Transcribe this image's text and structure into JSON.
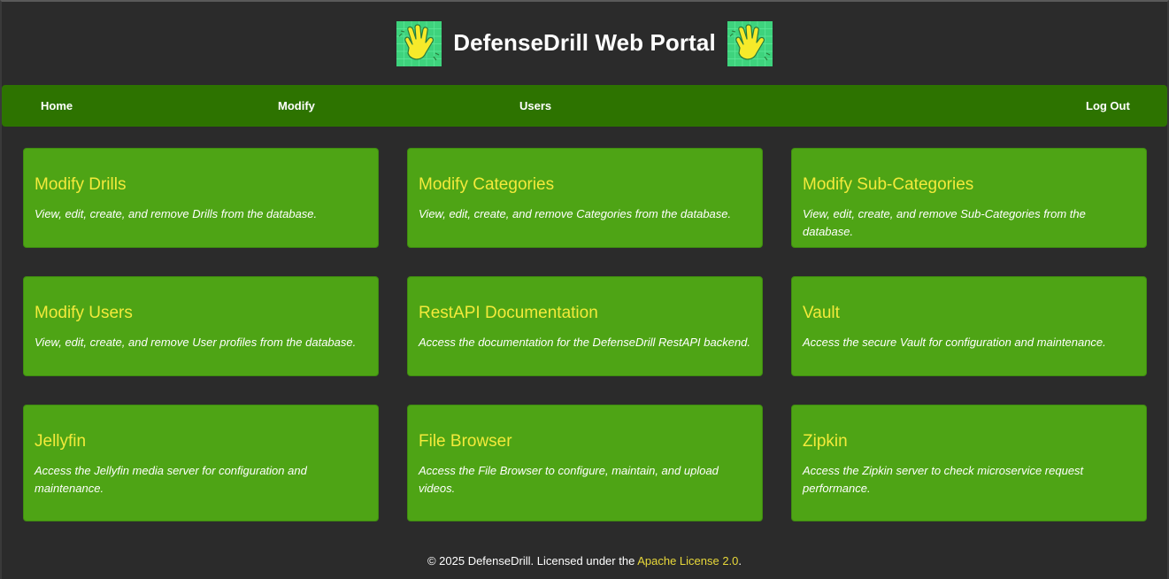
{
  "header": {
    "title": "DefenseDrill Web Portal",
    "logo_icon": "raised-hand-icon"
  },
  "nav": {
    "items": [
      {
        "label": "Home"
      },
      {
        "label": "Modify"
      },
      {
        "label": "Users"
      },
      {
        "label": "Log Out"
      }
    ]
  },
  "cards": [
    {
      "title": "Modify Drills",
      "description": "View, edit, create, and remove Drills from the database."
    },
    {
      "title": "Modify Categories",
      "description": "View, edit, create, and remove Categories from the database."
    },
    {
      "title": "Modify Sub-Categories",
      "description": "View, edit, create, and remove Sub-Categories from the database."
    },
    {
      "title": "Modify Users",
      "description": "View, edit, create, and remove User profiles from the database."
    },
    {
      "title": "RestAPI Documentation",
      "description": "Access the documentation for the DefenseDrill RestAPI backend."
    },
    {
      "title": "Vault",
      "description": "Access the secure Vault for configuration and maintenance."
    },
    {
      "title": "Jellyfin",
      "description": "Access the Jellyfin media server for configuration and maintenance."
    },
    {
      "title": "File Browser",
      "description": "Access the File Browser to configure, maintain, and upload videos."
    },
    {
      "title": "Zipkin",
      "description": "Access the Zipkin server to check microservice request performance."
    }
  ],
  "footer": {
    "text": "© 2025 DefenseDrill. Licensed under the ",
    "link_text": "Apache License 2.0",
    "suffix": "."
  },
  "colors": {
    "background": "#2b2b2b",
    "navbar": "#2d7300",
    "card": "#4ea415",
    "card_title": "#f3ea3b",
    "footer_link": "#e8d83a"
  }
}
